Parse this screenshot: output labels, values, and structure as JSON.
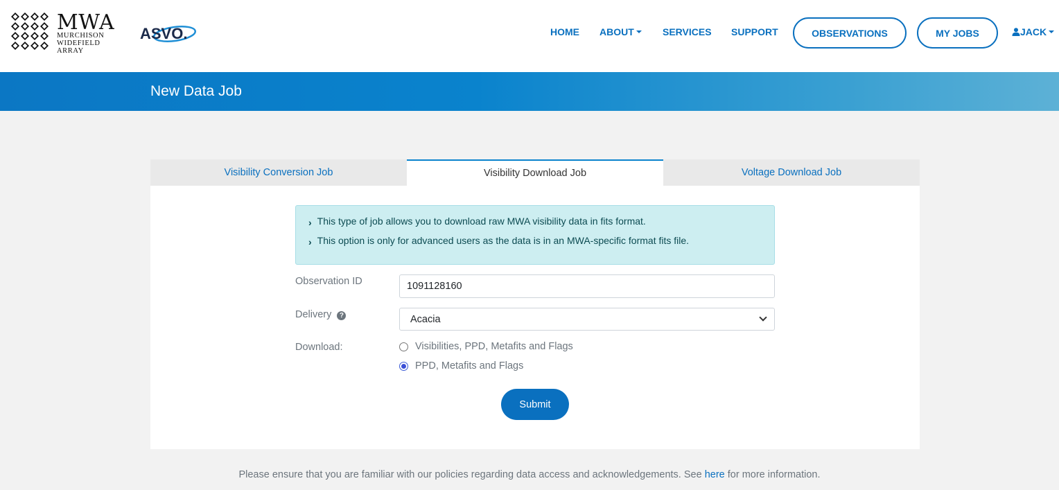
{
  "brand": {
    "mwa_title": "MWA",
    "mwa_subtitle_1": "MURCHISON",
    "mwa_subtitle_2": "WIDEFIELD",
    "mwa_subtitle_3": "ARRAY",
    "asvo_logo": "ASVO."
  },
  "nav": {
    "home": "HOME",
    "about": "ABOUT",
    "services": "SERVICES",
    "support": "SUPPORT",
    "observations": "OBSERVATIONS",
    "my_jobs": "MY JOBS",
    "user": "JACK"
  },
  "banner": {
    "title": "New Data Job"
  },
  "tabs": [
    {
      "label": "Visibility Conversion Job",
      "active": false
    },
    {
      "label": "Visibility Download Job",
      "active": true
    },
    {
      "label": "Voltage Download Job",
      "active": false
    }
  ],
  "alert": {
    "line1": "This type of job allows you to download raw MWA visibility data in fits format.",
    "line2": "This option is only for advanced users as the data is in an MWA-specific format fits file."
  },
  "form": {
    "observation_id_label": "Observation ID",
    "observation_id_value": "1091128160",
    "delivery_label": "Delivery",
    "delivery_value": "Acacia",
    "download_label": "Download:",
    "download_options": [
      {
        "label": "Visibilities, PPD, Metafits and Flags",
        "checked": false
      },
      {
        "label": "PPD, Metafits and Flags",
        "checked": true
      }
    ],
    "submit_label": "Submit"
  },
  "footer": {
    "note_before": "Please ensure that you are familiar with our policies regarding data access and acknowledgements. See ",
    "link": "here",
    "note_after": " for more information."
  },
  "colors": {
    "accent": "#0a70bf",
    "alert_bg": "#cdeef1",
    "page_bg": "#f2f2f2"
  }
}
